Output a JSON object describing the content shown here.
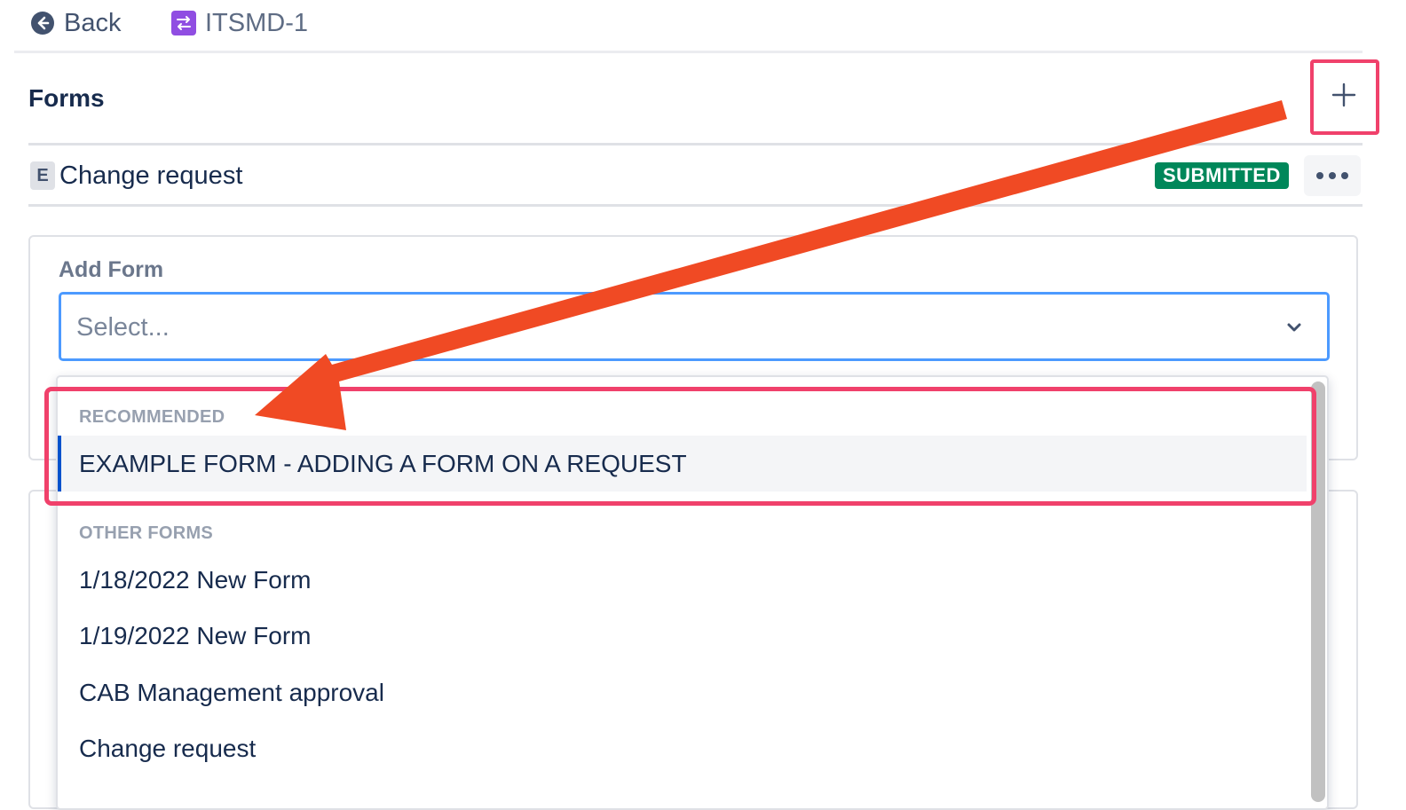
{
  "nav": {
    "back_label": "Back",
    "issue_key": "ITSMD-1"
  },
  "forms_panel": {
    "title": "Forms",
    "add_button_icon": "plus-icon",
    "attached_form": {
      "letter": "E",
      "name": "Change request",
      "status": "SUBMITTED",
      "status_color": "#00875a"
    }
  },
  "add_form": {
    "label": "Add Form",
    "placeholder": "Select...",
    "recommended_heading": "RECOMMENDED",
    "recommended_options": [
      "EXAMPLE FORM - ADDING A FORM ON A REQUEST"
    ],
    "other_heading": "OTHER FORMS",
    "other_options": [
      "1/18/2022 New Form",
      "1/19/2022 New Form",
      "CAB Management approval",
      "Change request"
    ]
  },
  "colors": {
    "annotation_highlight": "#f0416b",
    "annotation_arrow": "#f04a24",
    "select_focus_border": "#4c9aff"
  }
}
